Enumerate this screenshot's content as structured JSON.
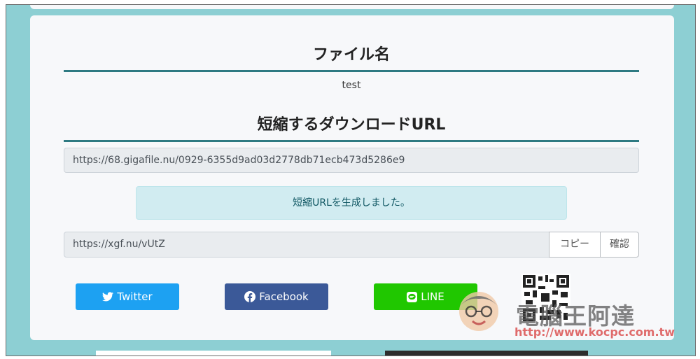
{
  "file_section": {
    "title": "ファイル名",
    "filename": "test"
  },
  "download_section": {
    "title": "短縮するダウンロードURL",
    "url": "https://68.gigafile.nu/0929-6355d9ad03d2778db71ecb473d5286e9",
    "alert": "短縮URLを生成しました。",
    "short_url": "https://xgf.nu/vUtZ",
    "copy_label": "コピー",
    "confirm_label": "確認"
  },
  "share": {
    "twitter_label": "Twitter",
    "facebook_label": "Facebook",
    "line_label": "LINE"
  },
  "watermark": {
    "text": "電腦王阿達",
    "url": "http://www.kocpc.com.tw"
  },
  "colors": {
    "background": "#8dcfd3",
    "accent": "#2e7a82",
    "twitter": "#1da1f2",
    "facebook": "#3b5998",
    "line": "#20c700"
  },
  "icons": [
    "twitter-icon",
    "facebook-icon",
    "line-icon",
    "qr-code-icon",
    "mascot-icon"
  ]
}
